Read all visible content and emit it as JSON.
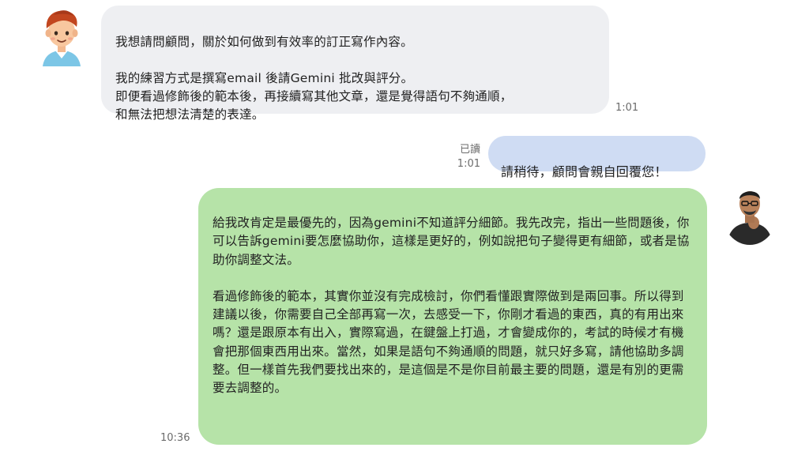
{
  "messages": {
    "incoming_1": {
      "text": "我想請問顧問，關於如何做到有效率的訂正寫作內容。\n\n我的練習方式是撰寫email 後請Gemini 批改與評分。\n即便看過修飾後的範本後，再接續寫其他文章，還是覺得語句不夠通順，\n和無法把想法清楚的表達。",
      "time": "1:01"
    },
    "outgoing_1": {
      "text": "請稍待，顧問會親自回覆您！",
      "read_label": "已讀",
      "time": "1:01"
    },
    "outgoing_2": {
      "text": "給我改肯定是最優先的，因為gemini不知道評分細節。我先改完，指出一些問題後，你可以告訴gemini要怎麼協助你，這樣是更好的，例如說把句子變得更有細節，或者是協助你調整文法。\n\n看過修飾後的範本，其實你並沒有完成檢討，你們看懂跟實際做到是兩回事。所以得到建議以後，你需要自己全部再寫一次，去感受一下，你剛才看過的東西，真的有用出來嗎？還是跟原本有出入，實際寫過，在鍵盤上打過，才會變成你的，考試的時候才有機會把那個東西用出來。當然，如果是語句不夠通順的問題，就只好多寫，請他協助多調整。但一樣首先我們要找出來的，是這個是不是你目前最主要的問題，還是有別的更需要去調整的。",
      "time": "10:36"
    }
  },
  "colors": {
    "incoming_bubble": "#eeeff2",
    "outgoing_short_bubble": "#cfdcf3",
    "outgoing_long_bubble": "#b6e3a8",
    "meta_text": "#6b6b6b"
  },
  "icons": {
    "user_avatar": "cartoon-user-avatar-icon",
    "consultant_avatar": "consultant-photo-avatar"
  }
}
